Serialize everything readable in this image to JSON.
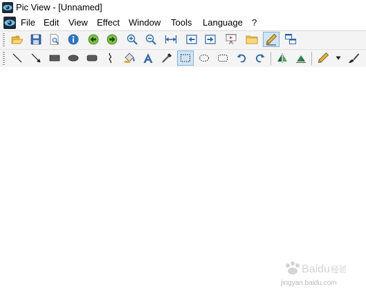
{
  "window": {
    "title": "Pic View - [Unnamed]"
  },
  "menu": {
    "items": [
      "File",
      "Edit",
      "View",
      "Effect",
      "Window",
      "Tools",
      "Language",
      "?"
    ]
  },
  "toolbar1": {
    "buttons": [
      "open-folder-icon",
      "save-icon",
      "print-preview-icon",
      "info-icon",
      "previous-icon",
      "next-icon",
      "zoom-in-icon",
      "zoom-out-icon",
      "fit-width-icon",
      "first-image-icon",
      "last-image-icon",
      "slideshow-icon",
      "browse-folder-icon",
      "edit-mode-icon",
      "multi-window-icon"
    ]
  },
  "toolbar2": {
    "buttons": [
      "line-tool-icon",
      "arrow-tool-icon",
      "rectangle-tool-icon",
      "ellipse-tool-icon",
      "rounded-rectangle-tool-icon",
      "freehand-tool-icon",
      "fill-bucket-icon",
      "text-tool-icon",
      "color-picker-icon",
      "rectangle-select-icon",
      "ellipse-select-icon",
      "rounded-select-icon",
      "undo-icon",
      "redo-icon",
      "flip-horizontal-icon",
      "flip-vertical-icon",
      "pen-icon",
      "pen-dropdown-icon",
      "brush-icon"
    ]
  },
  "watermark": {
    "logo_text": "Baidu 经验",
    "url": "jingyan.baidu.com"
  },
  "colors": {
    "toolbar_bg": "#f4f4f4",
    "active_button": "#cfe5f7",
    "canvas": "#ffffff"
  }
}
